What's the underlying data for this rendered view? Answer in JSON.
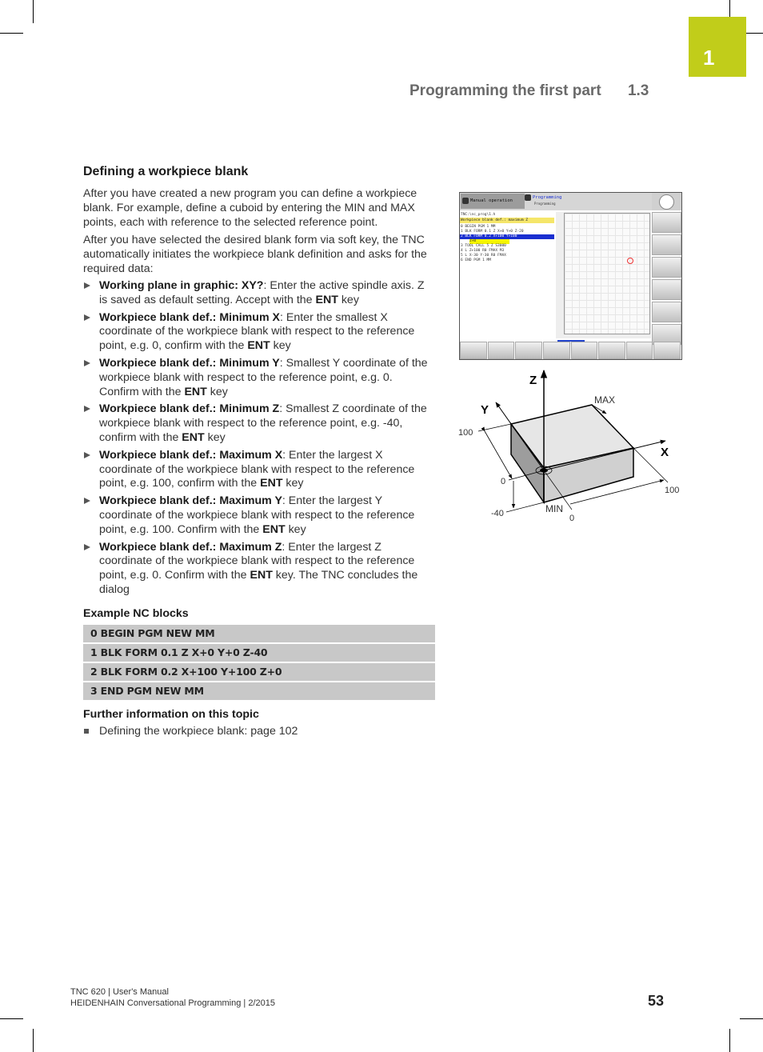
{
  "chapter": {
    "number": "1",
    "tab_color": "#c1cd1a"
  },
  "running_head": {
    "title": "Programming the first part",
    "section": "1.3"
  },
  "section": {
    "heading": "Defining a workpiece blank",
    "paragraphs": [
      "After you have created a new program you can define a workpiece blank. For example, define a cuboid by entering the MIN and MAX points, each with reference to the selected reference point.",
      "After you have selected the desired blank form via soft key, the TNC automatically initiates the workpiece blank definition and asks for the required data:"
    ],
    "steps": [
      {
        "bold": "Working plane in graphic: XY?",
        "text": ": Enter the active spindle axis. Z is saved as default setting. Accept with the ",
        "key": "ENT",
        "tail": " key"
      },
      {
        "bold": "Workpiece blank def.: Minimum X",
        "text": ": Enter the smallest X coordinate of the workpiece blank with respect to the reference point, e.g. 0, confirm with the ",
        "key": "ENT",
        "tail": " key"
      },
      {
        "bold": "Workpiece blank def.: Minimum Y",
        "text": ": Smallest Y coordinate of the workpiece blank with respect to the reference point, e.g. 0. Confirm with the ",
        "key": "ENT",
        "tail": " key"
      },
      {
        "bold": "Workpiece blank def.: Minimum Z",
        "text": ": Smallest Z coordinate of the workpiece blank with respect to the reference point, e.g. -40, confirm with the ",
        "key": "ENT",
        "tail": " key"
      },
      {
        "bold": "Workpiece blank def.: Maximum X",
        "text": ": Enter the largest X coordinate of the workpiece blank with respect to the reference point, e.g. 100, confirm with the ",
        "key": "ENT",
        "tail": " key"
      },
      {
        "bold": "Workpiece blank def.: Maximum Y",
        "text": ": Enter the largest Y coordinate of the workpiece blank with respect to the reference point, e.g. 100. Confirm with the ",
        "key": "ENT",
        "tail": " key"
      },
      {
        "bold": "Workpiece blank def.: Maximum Z",
        "text": ": Enter the largest Z coordinate of the workpiece blank with respect to the reference point, e.g. 0. Confirm with the ",
        "key": "ENT",
        "tail": " key. The TNC concludes the dialog"
      }
    ],
    "example_heading": "Example NC blocks",
    "nc_blocks": [
      "0 BEGIN PGM NEW MM",
      "1 BLK FORM 0.1 Z X+0 Y+0 Z-40",
      "2 BLK FORM 0.2 X+100 Y+100 Z+0",
      "3 END PGM NEW MM"
    ],
    "further_heading": "Further information on this topic",
    "further_items": [
      "Defining the workpiece blank: page 102"
    ]
  },
  "screenshot": {
    "mode_manual": "Manual operation",
    "mode_programming": "Programming",
    "mode_programming_sub": "Programming",
    "file": "TNC:\\nc_prog\\1.h",
    "prompt": "Workpiece blank def.: maximum Z",
    "program_lines": [
      "0  BEGIN PGM 1 MM",
      "1  BLK FORM 0.1 Z X+0 Y+0 Z-20",
      "2  BLK FORM 0.2  X+100  Y+100",
      "3  TOOL CALL 5 Z S3000",
      "4  L  Z+100 R0 FMAX M3",
      "5  L  X-30  Y-30 R0 FMAX",
      "6  END PGM 1 MM"
    ],
    "input_value": "Z+0",
    "accent_blue": "#1a2fd0",
    "prompt_color": "#f5e66a"
  },
  "diagram": {
    "axis_z": "Z",
    "axis_y": "Y",
    "axis_x": "X",
    "label_max": "MAX",
    "label_min": "MIN",
    "y_100": "100",
    "y_0": "0",
    "z_neg40": "-40",
    "x_0": "0",
    "x_100": "100"
  },
  "footer": {
    "line1": "TNC 620 | User's Manual",
    "line2": "HEIDENHAIN Conversational Programming | 2/2015",
    "page_number": "53"
  }
}
